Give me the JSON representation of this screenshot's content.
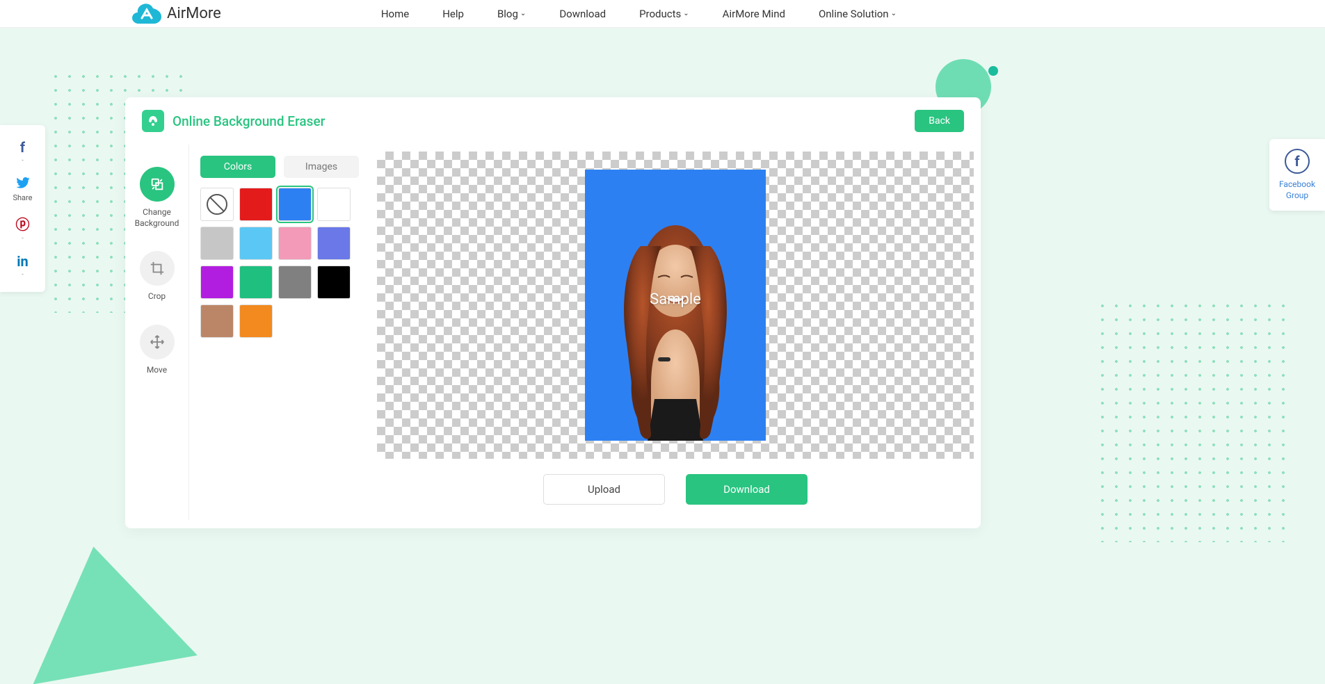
{
  "brand": "AirMore",
  "nav": [
    "Home",
    "Help",
    "Blog",
    "Download",
    "Products",
    "AirMore Mind",
    "Online Solution"
  ],
  "nav_has_chevron": [
    false,
    false,
    true,
    false,
    true,
    false,
    true
  ],
  "share": {
    "label": "Share"
  },
  "fb_group": "Facebook Group",
  "tool": {
    "title": "Online Background Eraser",
    "back": "Back",
    "items": [
      {
        "label": "Change Background"
      },
      {
        "label": "Crop"
      },
      {
        "label": "Move"
      }
    ],
    "tabs": {
      "colors": "Colors",
      "images": "Images"
    },
    "colors": [
      "none",
      "#e41b1b",
      "#2d80f2",
      "#ffffff",
      "#c6c6c6",
      "#5bc7f4",
      "#f29ab8",
      "#6a78e8",
      "#b21ee0",
      "#1fbf80",
      "#808080",
      "#000000",
      "#bb8668",
      "#f28a1f"
    ],
    "selected_color_index": 2,
    "sample_label": "Sample",
    "upload": "Upload",
    "download": "Download"
  }
}
